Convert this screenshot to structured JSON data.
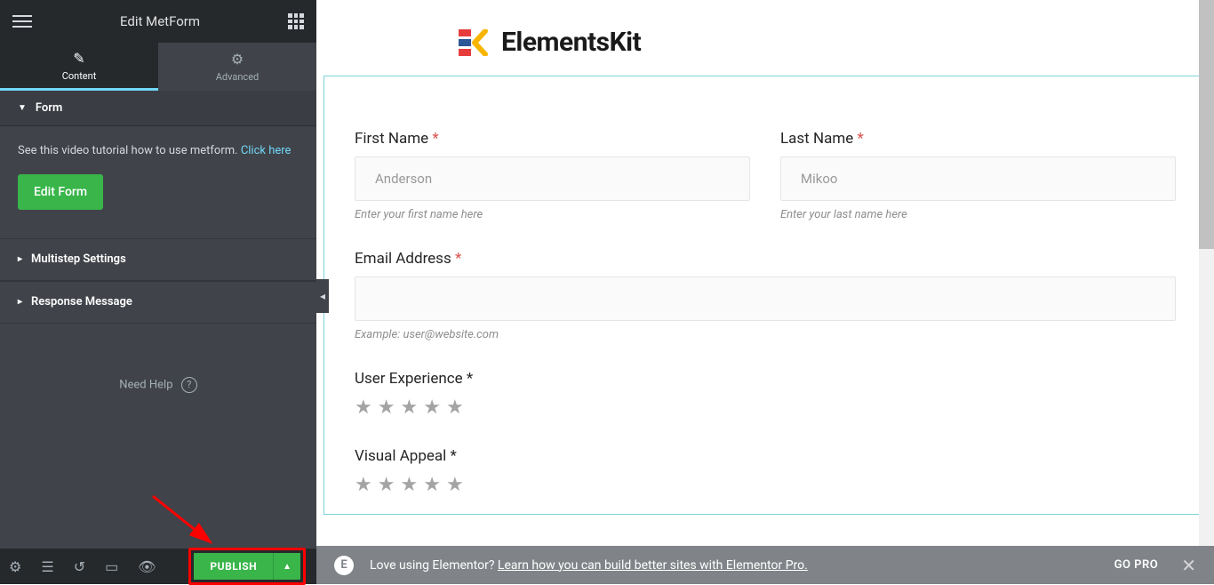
{
  "header": {
    "title": "Edit MetForm"
  },
  "tabs": {
    "content": "Content",
    "advanced": "Advanced"
  },
  "sections": {
    "form": "Form",
    "multistep": "Multistep Settings",
    "response": "Response Message"
  },
  "form_panel": {
    "tutorial_prefix": "See this video tutorial how to use metform. ",
    "tutorial_link": "Click here",
    "edit_btn": "Edit Form"
  },
  "need_help": "Need Help",
  "footer": {
    "publish": "PUBLISH"
  },
  "bottombar": {
    "prefix": "Love using Elementor? ",
    "link": "Learn how you can build better sites with Elementor Pro.",
    "go_pro": "GO PRO"
  },
  "logo": "ElementsKit",
  "fields": {
    "first_name": {
      "label": "First Name ",
      "placeholder": "Anderson",
      "helper": "Enter your first name here"
    },
    "last_name": {
      "label": "Last Name ",
      "placeholder": "Mikoo",
      "helper": "Enter your last name here"
    },
    "email": {
      "label": "Email Address ",
      "helper": "Example: user@website.com"
    },
    "ux": {
      "label": "User Experience *"
    },
    "visual": {
      "label": "Visual Appeal *"
    }
  },
  "asterisk": "*"
}
